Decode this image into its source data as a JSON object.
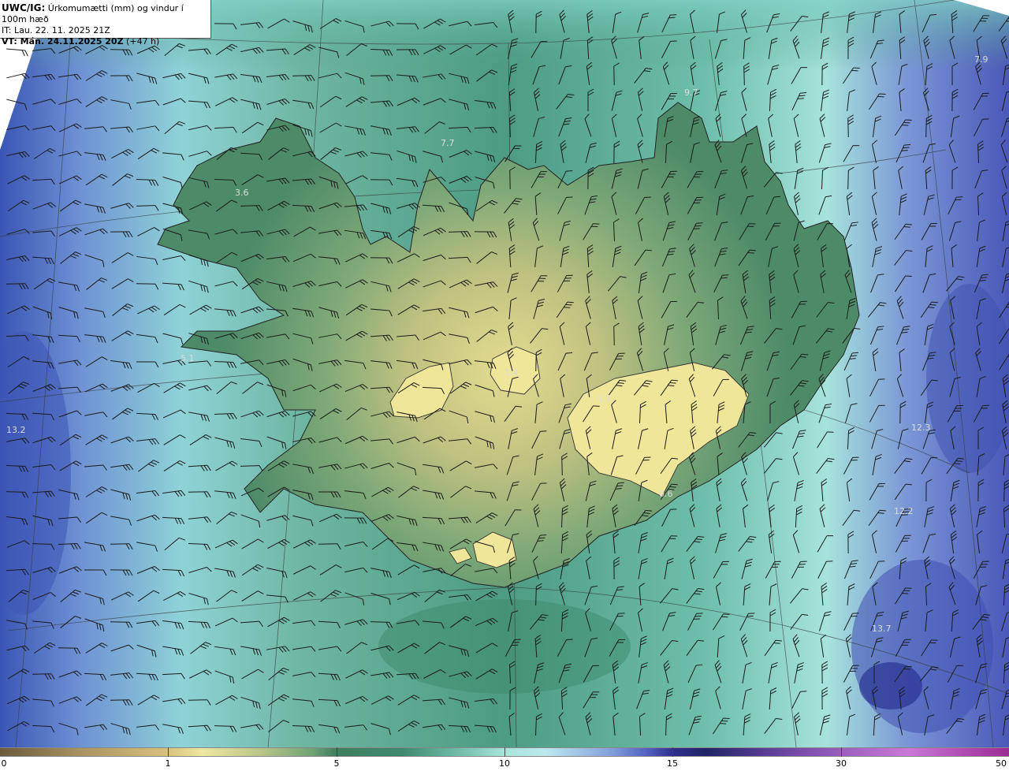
{
  "header": {
    "model": "UWC/IG:",
    "title": " Úrkomumætti (mm) og vindur í 100m hæð",
    "issue_time": "IT: Lau. 22. 11. 2025 21Z",
    "valid_prefix": "VT: Mán. 24.11.2025 20Z",
    "valid_offset": " (+47 h)"
  },
  "map": {
    "value_labels": [
      "7.9",
      "9.7",
      "7.7",
      "3.6",
      "5.1",
      "13.2",
      "1.4",
      "1.1",
      "0.6",
      "12.3",
      "12.2",
      "13.7"
    ]
  },
  "colorbar": {
    "ticks": [
      "0",
      "1",
      "5",
      "10",
      "15",
      "30",
      "50"
    ],
    "colors": {
      "0": "#6b5a3a",
      "1": "#efe8a0",
      "5": "#3f7d5e",
      "10": "#bde9ef",
      "15": "#2e2f8e",
      "30": "#c978d6",
      "50": "#9c2a92"
    }
  },
  "icons": {
    "wind": "wind-barb-icon",
    "coast": "coastline"
  }
}
